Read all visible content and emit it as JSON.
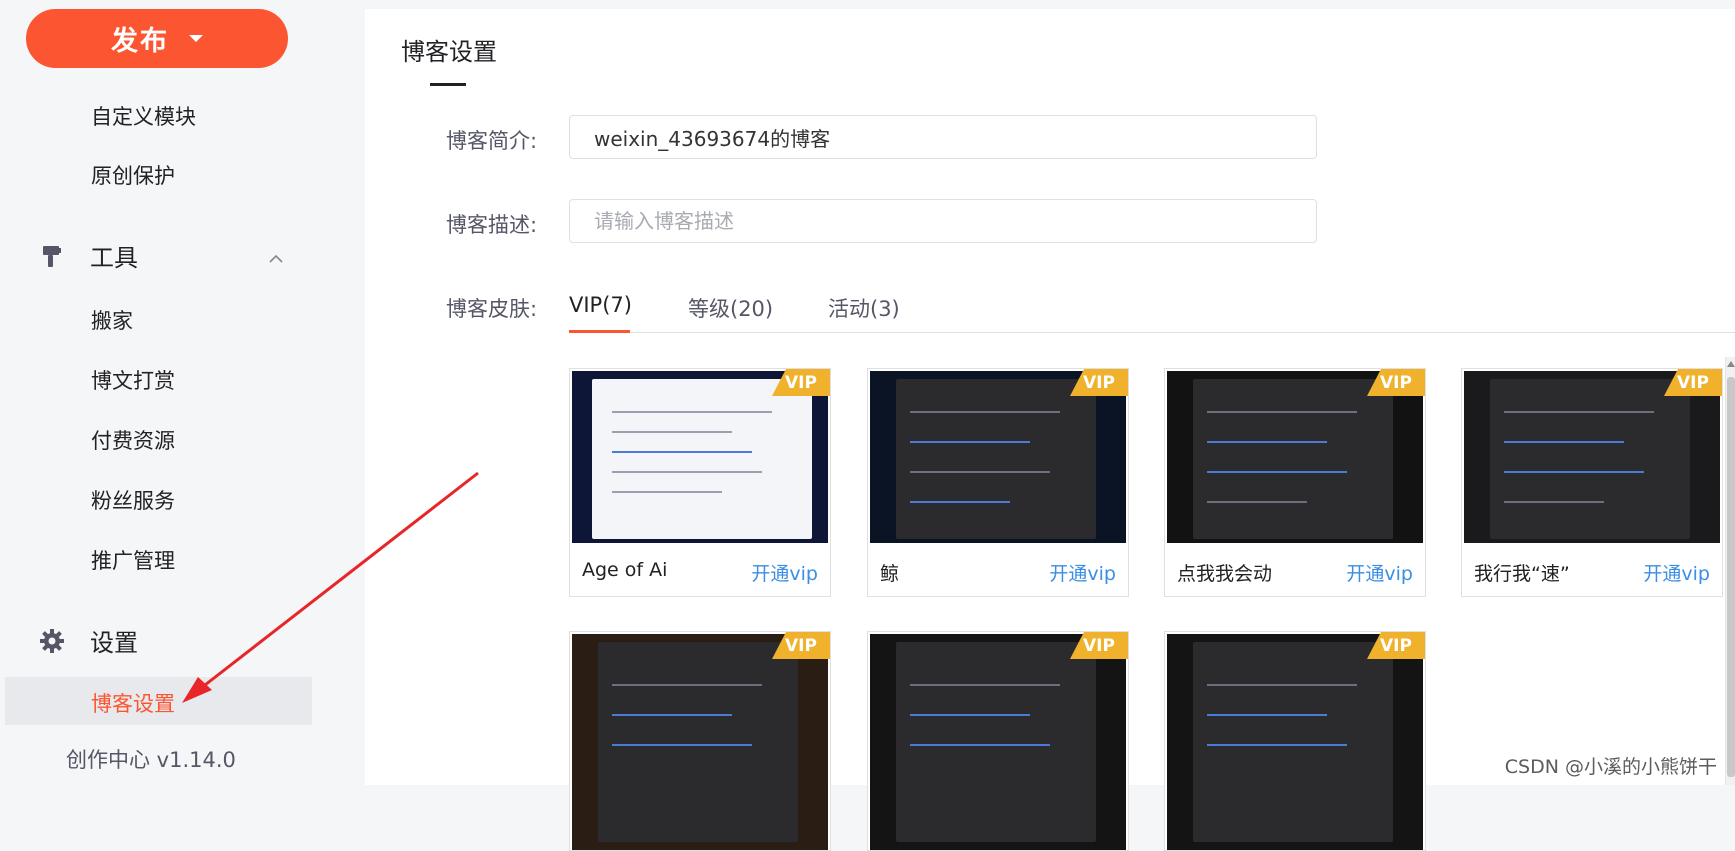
{
  "sidebar": {
    "publish_label": "发布",
    "items_content": [
      "自定义模块",
      "原创保护"
    ],
    "tools_group": "工具",
    "tools_items": [
      "搬家",
      "博文打赏",
      "付费资源",
      "粉丝服务",
      "推广管理"
    ],
    "settings_group": "设置",
    "active_item": "博客设置",
    "version": "创作中心 v1.14.0"
  },
  "main": {
    "title": "博客设置",
    "intro_label": "博客简介:",
    "intro_value": "weixin_43693674的博客",
    "desc_label": "博客描述:",
    "desc_placeholder": "请输入博客描述",
    "skin_label": "博客皮肤:",
    "tabs": [
      "VIP(7)",
      "等级(20)",
      "活动(3)"
    ],
    "vip_badge": "VIP",
    "open_label": "开通vip",
    "skins": [
      {
        "name": "Age of Ai",
        "theme": "light"
      },
      {
        "name": "鲸",
        "theme": "dark"
      },
      {
        "name": "点我我会动",
        "theme": "dark"
      },
      {
        "name": "我行我“速”",
        "theme": "dark"
      },
      {
        "name": "",
        "theme": "brown"
      },
      {
        "name": "",
        "theme": "dark"
      },
      {
        "name": "",
        "theme": "dark"
      }
    ]
  },
  "watermark": "CSDN @小溪的小熊饼干",
  "colors": {
    "accent": "#fc5531",
    "vip": "#f0b22c",
    "link": "#3a8ee6",
    "annotation_arrow": "#e8262a"
  }
}
